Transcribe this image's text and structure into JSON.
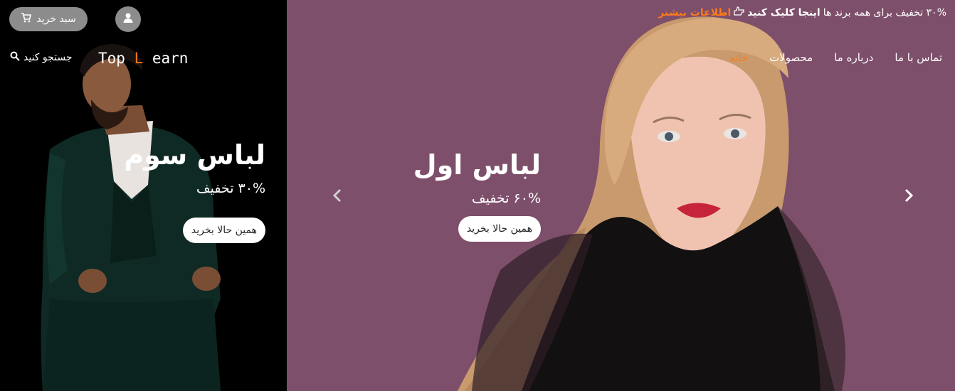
{
  "header": {
    "cart_label": "سبد خرید",
    "search_label": "جستجو کنید",
    "logo_part1": "Top ",
    "logo_accent": "L",
    "logo_part2": " earn"
  },
  "promo": {
    "text": "۳۰% تخفیف برای همه برند ها",
    "click_here": "اینجا کلیک کنید",
    "more_info": "اطلاعات بیشتر"
  },
  "nav": {
    "items": [
      {
        "label": "خانه",
        "active": true
      },
      {
        "label": "محصولات",
        "active": false
      },
      {
        "label": "درباره ما",
        "active": false
      },
      {
        "label": "تماس با ما",
        "active": false
      }
    ]
  },
  "slides": {
    "left": {
      "title": "لباس سوم",
      "discount": "۳۰% تخفیف",
      "button": "همین حالا بخرید"
    },
    "right": {
      "title": "لباس اول",
      "discount": "۶۰% تخفیف",
      "button": "همین حالا بخرید"
    }
  },
  "colors": {
    "accent": "#ff7a1a",
    "right_bg": "#7e4f6a",
    "left_bg": "#000000",
    "pill_bg": "#8c8c8c"
  },
  "icons": [
    "cart-icon",
    "user-icon",
    "search-icon",
    "hand-pointer-icon",
    "chevron-left-icon",
    "chevron-right-icon"
  ]
}
